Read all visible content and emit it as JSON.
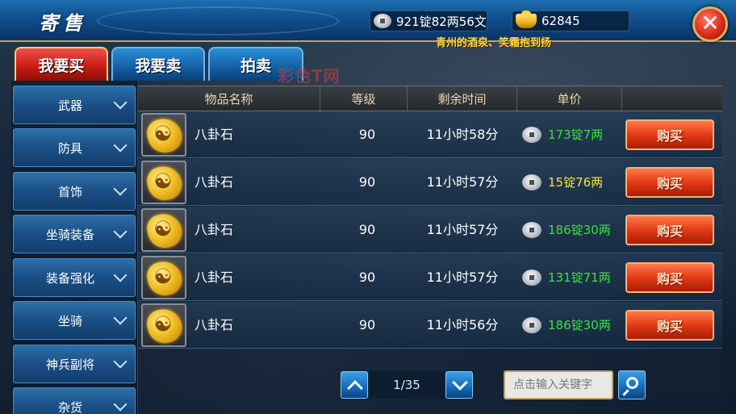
{
  "window": {
    "title": "寄售"
  },
  "currency": {
    "silver": "921锭82两56文",
    "gold": "62845"
  },
  "notice": "青州的酒泉、笑霜抱到扬",
  "tabs": [
    {
      "label": "我要买",
      "active": true
    },
    {
      "label": "我要卖",
      "active": false
    },
    {
      "label": "拍卖",
      "active": false
    }
  ],
  "watermark": "彩色T网",
  "categories": [
    {
      "label": "武器"
    },
    {
      "label": "防具"
    },
    {
      "label": "首饰"
    },
    {
      "label": "坐骑装备"
    },
    {
      "label": "装备强化"
    },
    {
      "label": "坐骑"
    },
    {
      "label": "神兵副将"
    },
    {
      "label": "杂货"
    }
  ],
  "table": {
    "headers": {
      "name": "物品名称",
      "level": "等级",
      "time": "剩余时间",
      "price": "单价"
    },
    "rows": [
      {
        "icon": "bagua-stone-icon",
        "name": "八卦石",
        "level": "90",
        "time": "11小时58分",
        "price": "173锭7两",
        "price_color": "#3ee03a",
        "buy": "购买"
      },
      {
        "icon": "bagua-stone-icon",
        "name": "八卦石",
        "level": "90",
        "time": "11小时57分",
        "price": "15锭76两",
        "price_color": "#f5e23c",
        "buy": "购买"
      },
      {
        "icon": "bagua-stone-icon",
        "name": "八卦石",
        "level": "90",
        "time": "11小时57分",
        "price": "186锭30两",
        "price_color": "#3ee03a",
        "buy": "购买"
      },
      {
        "icon": "bagua-stone-icon",
        "name": "八卦石",
        "level": "90",
        "time": "11小时57分",
        "price": "131锭71两",
        "price_color": "#3ee03a",
        "buy": "购买"
      },
      {
        "icon": "bagua-stone-icon",
        "name": "八卦石",
        "level": "90",
        "time": "11小时56分",
        "price": "186锭30两",
        "price_color": "#3ee03a",
        "buy": "购买"
      }
    ]
  },
  "pagination": {
    "indicator": "1/35"
  },
  "search": {
    "placeholder": "点击输入关键字"
  },
  "colors": {
    "accent_red": "#e33a14",
    "accent_blue": "#1463a8",
    "gold_border": "#c9a24a"
  }
}
